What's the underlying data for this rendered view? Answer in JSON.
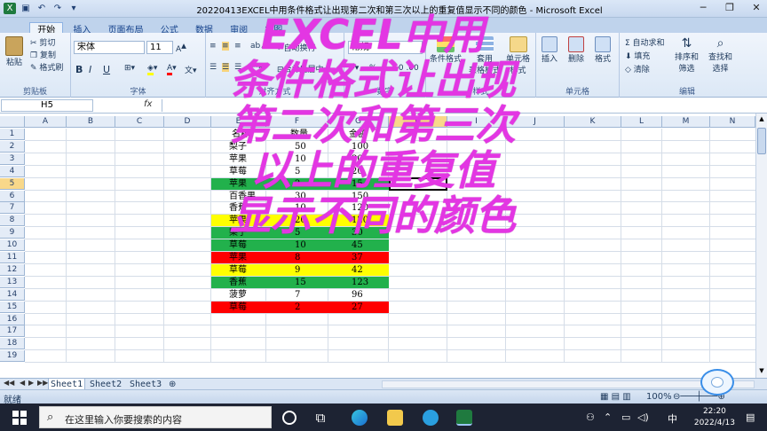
{
  "window": {
    "title": "20220413EXCEL中用条件格式让出现第二次和第三次以上的重复值显示不同的颜色 - Microsoft Excel",
    "controls": [
      "─",
      "❐",
      "✕"
    ]
  },
  "ribbon_tabs": [
    "开始",
    "插入",
    "页面布局",
    "公式",
    "数据",
    "审阅",
    "视图"
  ],
  "ribbon": {
    "clipboard": {
      "paste": "粘贴",
      "cut": "剪切",
      "copy": "复制",
      "format_painter": "格式刷",
      "label": "剪贴板"
    },
    "font": {
      "name": "宋体",
      "size": "11",
      "label": "字体",
      "bold": "B",
      "italic": "I",
      "underline": "U"
    },
    "alignment": {
      "wrap": "自动换行",
      "merge": "合并后居中",
      "label": "对齐方式"
    },
    "number": {
      "format": "常规",
      "percent": "% ,",
      "label": "数字"
    },
    "styles": {
      "cond_format": "条件格式",
      "table_format_1": "套用",
      "table_format_2": "表格格式",
      "cell_styles_1": "单元格",
      "cell_styles_2": "样式",
      "label": "样式"
    },
    "cells": {
      "insert": "插入",
      "delete": "删除",
      "format": "格式",
      "label": "单元格"
    },
    "editing": {
      "autosum": "Σ 自动求和",
      "fill": "填充",
      "clear": "清除",
      "sort_1": "排序和",
      "sort_2": "筛选",
      "find_1": "查找和",
      "find_2": "选择",
      "label": "编辑"
    }
  },
  "formula_bar": {
    "name_box": "H5",
    "fx": "fx",
    "formula": ""
  },
  "columns": [
    "A",
    "B",
    "C",
    "D",
    "E",
    "F",
    "G",
    "H",
    "I",
    "J",
    "K",
    "L",
    "M",
    "N"
  ],
  "rows": [
    "1",
    "2",
    "3",
    "4",
    "5",
    "6",
    "7",
    "8",
    "9",
    "10",
    "11",
    "12",
    "13",
    "14",
    "15",
    "16",
    "17",
    "18",
    "19"
  ],
  "selected_cell": "H5",
  "table": {
    "headers": [
      "名称",
      "数量",
      "金额"
    ],
    "rows": [
      {
        "name": "梨子",
        "qty": "50",
        "amount": "100",
        "fill": ""
      },
      {
        "name": "苹果",
        "qty": "10",
        "amount": "30",
        "fill": ""
      },
      {
        "name": "草莓",
        "qty": "5",
        "amount": "20",
        "fill": ""
      },
      {
        "name": "苹果",
        "qty": "2",
        "amount": "15",
        "fill": "#22b14c"
      },
      {
        "name": "百香果",
        "qty": "30",
        "amount": "150",
        "fill": ""
      },
      {
        "name": "香蕉",
        "qty": "10",
        "amount": "120",
        "fill": ""
      },
      {
        "name": "苹果",
        "qty": "20",
        "amount": "120",
        "fill": "#ffff00"
      },
      {
        "name": "梨子",
        "qty": "5",
        "amount": "30",
        "fill": "#22b14c"
      },
      {
        "name": "草莓",
        "qty": "10",
        "amount": "45",
        "fill": "#22b14c"
      },
      {
        "name": "苹果",
        "qty": "8",
        "amount": "37",
        "fill": "#ff0000"
      },
      {
        "name": "草莓",
        "qty": "9",
        "amount": "42",
        "fill": "#ffff00"
      },
      {
        "name": "香蕉",
        "qty": "15",
        "amount": "123",
        "fill": "#22b14c"
      },
      {
        "name": "菠萝",
        "qty": "7",
        "amount": "96",
        "fill": ""
      },
      {
        "name": "草莓",
        "qty": "2",
        "amount": "27",
        "fill": "#ff0000"
      }
    ]
  },
  "overlay_text": [
    "EXCEL中用",
    "条件格式让出现",
    "第二次和第三次",
    "以上的重复值",
    "显示不同的颜色"
  ],
  "sheets": [
    "Sheet1",
    "Sheet2",
    "Sheet3"
  ],
  "status": {
    "ready": "就绪",
    "zoom": "100%"
  },
  "taskbar": {
    "search_placeholder": "在这里输入你要搜索的内容",
    "ime": "中",
    "time": "22:20",
    "date": "2022/4/13"
  },
  "colors": {
    "green": "#22b14c",
    "yellow": "#ffff00",
    "red": "#ff0000",
    "overlay": "#e336e3"
  }
}
